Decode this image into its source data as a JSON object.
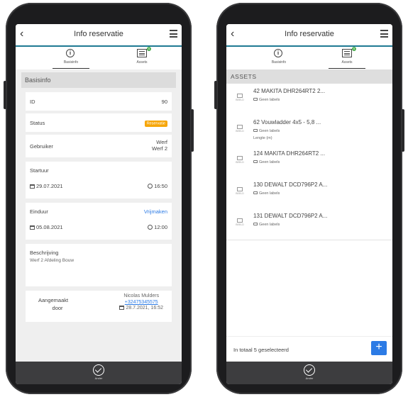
{
  "left": {
    "title": "Info reservatie",
    "tabs": [
      {
        "label": "Basisinfo",
        "icon": "info-icon",
        "active": true
      },
      {
        "label": "Assets",
        "icon": "list-icon",
        "badge": "5",
        "active": false
      }
    ],
    "section": "Basisinfo",
    "fields": {
      "id_label": "ID",
      "id_value": "90",
      "status_label": "Status",
      "status_value": "Reservatie",
      "user_label": "Gebruiker",
      "user_value_1": "Werf",
      "user_value_2": "Werf 2",
      "start_label": "Startuur",
      "start_date": "29.07.2021",
      "start_time": "16:50",
      "end_label": "Einduur",
      "end_action": "Vrijmaken",
      "end_date": "05.08.2021",
      "end_time": "12:00",
      "desc_label": "Beschrijving",
      "desc_value": "Werf 2 Afdeling Bouw",
      "created_label_1": "Aangemaakt",
      "created_label_2": "door",
      "created_name": "Nicolas Mulders",
      "created_phone": "+32475345575",
      "created_datetime": "28.7.2021, 16:52"
    },
    "bottom_label": "Ander"
  },
  "right": {
    "title": "Info reservatie",
    "tabs": [
      {
        "label": "Basisinfo",
        "icon": "info-icon",
        "active": false
      },
      {
        "label": "Assets",
        "icon": "list-icon",
        "badge": "5",
        "active": true
      }
    ],
    "section": "ASSETS",
    "assets": [
      {
        "name": "42 MAKITA DHR264RT2 2...",
        "tag": "Geen labels",
        "extra": ""
      },
      {
        "name": "62 Vouwladder 4x5 - 5,8 ...",
        "tag": "Geen labels",
        "extra": "Lengte (m)"
      },
      {
        "name": "124 MAKITA DHR264RT2 ...",
        "tag": "Geen labels",
        "extra": ""
      },
      {
        "name": "130 DEWALT DCD796P2 A...",
        "tag": "Geen labels",
        "extra": ""
      },
      {
        "name": "131 DEWALT DCD796P2 A...",
        "tag": "Geen labels",
        "extra": ""
      }
    ],
    "thumb_text": "BEELD",
    "footer_text": "In totaal 5 geselecteerd",
    "add_label": "+",
    "bottom_label": "Ander"
  },
  "colors": {
    "accent": "#1f7a93",
    "status": "#f6a609",
    "link": "#2c7be5",
    "badge": "#4caf50",
    "bottom": "#3d3d3f"
  }
}
